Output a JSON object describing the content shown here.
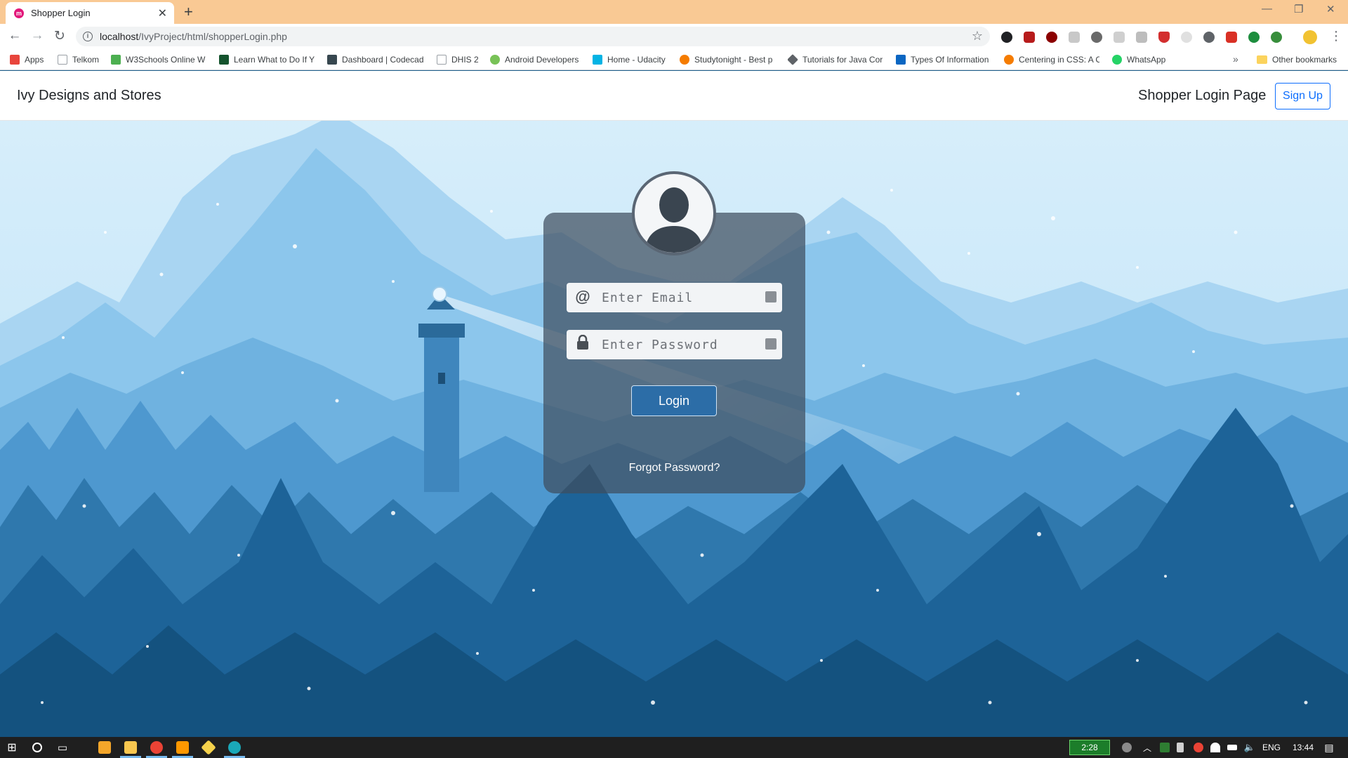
{
  "browser": {
    "tab_title": "Shopper Login",
    "tab_favicon_letter": "m",
    "url_host": "localhost",
    "url_path": "/IvyProject/html/shopperLogin.php",
    "bookmarks": [
      {
        "label": "Apps",
        "color": "#e8453c"
      },
      {
        "label": "Telkom",
        "color": "#9aa0a6"
      },
      {
        "label": "W3Schools Online W",
        "color": "#4caf50"
      },
      {
        "label": "Learn What to Do If Y",
        "color": "#14532d"
      },
      {
        "label": "Dashboard | Codecad",
        "color": "#37474f"
      },
      {
        "label": "DHIS 2",
        "color": "#9aa0a6"
      },
      {
        "label": "Android Developers",
        "color": "#78c257"
      },
      {
        "label": "Home - Udacity",
        "color": "#02b3e4"
      },
      {
        "label": "Studytonight - Best p",
        "color": "#f57c00"
      },
      {
        "label": "Tutorials for Java Cor",
        "color": "#5f6368"
      },
      {
        "label": "Types Of Information",
        "color": "#0a66c2"
      },
      {
        "label": "Centering in CSS: A C",
        "color": "#f57c00"
      },
      {
        "label": "WhatsApp",
        "color": "#25d366"
      }
    ],
    "more_bookmarks": "»",
    "other_bookmarks": "Other bookmarks"
  },
  "navbar": {
    "brand": "Ivy Designs and Stores",
    "page_label": "Shopper Login Page",
    "signup_label": "Sign Up"
  },
  "login": {
    "email_placeholder": "Enter Email",
    "password_placeholder": "Enter Password",
    "email_icon": "@",
    "login_label": "Login",
    "forgot_label": "Forgot Password?"
  },
  "taskbar": {
    "battery_time": "2:28",
    "language": "ENG",
    "clock": "13:44"
  },
  "colors": {
    "titlebar": "#f9c994",
    "accent": "#0d6efd",
    "login_button": "#2c6da7"
  }
}
